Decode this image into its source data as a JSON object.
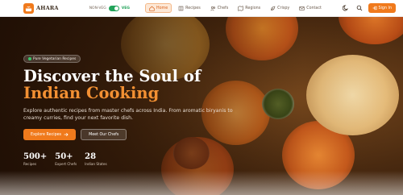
{
  "brand": {
    "name": "AHARA",
    "logo_icon": "cooking-pot-icon",
    "accent": "#f07a1c"
  },
  "diet_toggle": {
    "off_label": "NON-VEG",
    "on_label": "VEG",
    "on_color": "#22a35a"
  },
  "nav": {
    "items": [
      {
        "label": "Home",
        "icon": "home-icon",
        "active": true
      },
      {
        "label": "Recipes",
        "icon": "book-icon"
      },
      {
        "label": "Chefs",
        "icon": "users-icon"
      },
      {
        "label": "Regions",
        "icon": "map-icon"
      },
      {
        "label": "Crispy",
        "icon": "leaf-icon"
      },
      {
        "label": "Contact",
        "icon": "mail-icon"
      }
    ]
  },
  "header_actions": {
    "theme_icon": "moon-icon",
    "search_icon": "search-icon",
    "signin_label": "Sign In"
  },
  "hero": {
    "badge": "Pure Vegetarian Recipes",
    "title_line1": "Discover the Soul of",
    "title_line2": "Indian Cooking",
    "description": "Explore authentic recipes from master chefs across India. From aromatic biryanis to creamy curries, find your next favorite dish.",
    "primary_cta": "Explore Recipes",
    "secondary_cta": "Meet Our Chefs"
  },
  "stats": [
    {
      "value": "500+",
      "label": "Recipes"
    },
    {
      "value": "50+",
      "label": "Expert Chefs"
    },
    {
      "value": "28",
      "label": "Indian States"
    }
  ]
}
